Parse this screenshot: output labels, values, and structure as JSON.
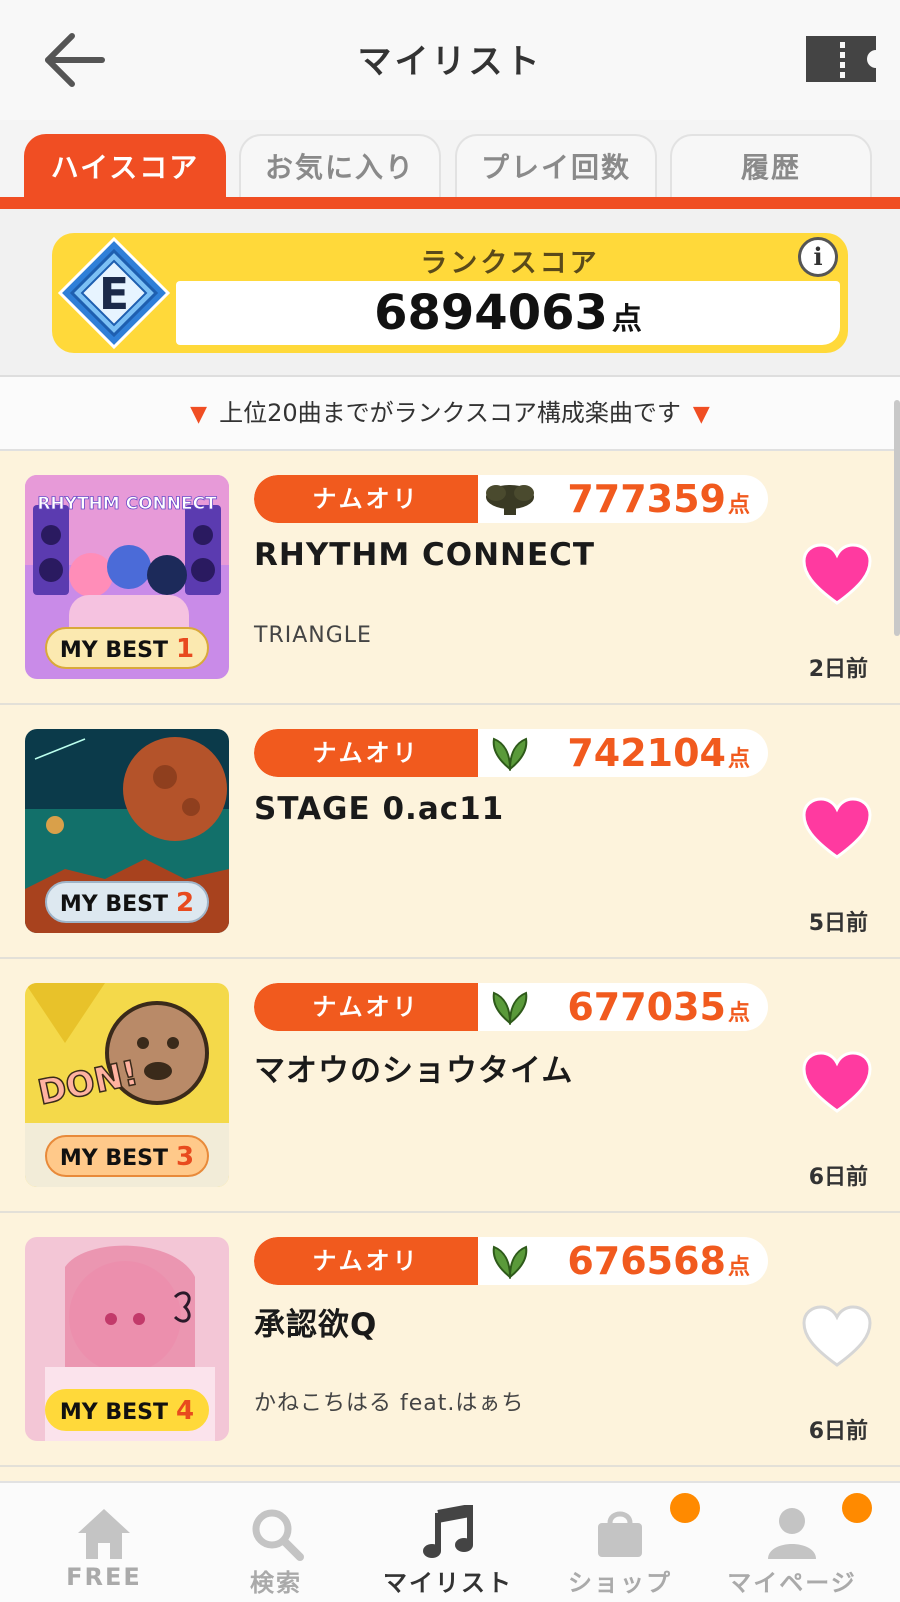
{
  "header": {
    "title": "マイリスト",
    "back_icon": "arrow-left-icon",
    "ticket_icon": "ticket-icon"
  },
  "tabs": [
    {
      "label": "ハイスコア",
      "active": true
    },
    {
      "label": "お気に入り",
      "active": false
    },
    {
      "label": "プレイ回数",
      "active": false
    },
    {
      "label": "履歴",
      "active": false
    }
  ],
  "rank": {
    "label": "ランクスコア",
    "grade": "E",
    "value": "6894063",
    "unit": "点",
    "info_label": "i"
  },
  "notice": {
    "text": "上位20曲までがランクスコア構成楽曲です"
  },
  "songs": [
    {
      "rank_label": "MY BEST",
      "rank": "1",
      "genre": "ナムオリ",
      "crown_icon": "dark-crown-icon",
      "score": "777359",
      "score_unit": "点",
      "title": "RHYTHM CONNECT",
      "artist": "TRIANGLE",
      "favorite": true,
      "ago": "2日前",
      "jacket_text": "RHYTHM CONNECT"
    },
    {
      "rank_label": "MY BEST",
      "rank": "2",
      "genre": "ナムオリ",
      "crown_icon": "green-leaf-icon",
      "score": "742104",
      "score_unit": "点",
      "title": "STAGE 0.ac11",
      "artist": "",
      "favorite": true,
      "ago": "5日前"
    },
    {
      "rank_label": "MY BEST",
      "rank": "3",
      "genre": "ナムオリ",
      "crown_icon": "green-leaf-icon",
      "score": "677035",
      "score_unit": "点",
      "title": "マオウのショウタイム",
      "artist": "",
      "favorite": true,
      "ago": "6日前",
      "jacket_text": "DON!"
    },
    {
      "rank_label": "MY BEST",
      "rank": "4",
      "genre": "ナムオリ",
      "crown_icon": "green-leaf-icon",
      "score": "676568",
      "score_unit": "点",
      "title": "承認欲Q",
      "artist": "かねこちはる feat.はぁち",
      "favorite": false,
      "ago": "6日前"
    }
  ],
  "nav": [
    {
      "label": "FREE",
      "icon": "home-icon",
      "active": false,
      "badge": false
    },
    {
      "label": "検索",
      "icon": "search-icon",
      "active": false,
      "badge": false
    },
    {
      "label": "マイリスト",
      "icon": "music-note-icon",
      "active": true,
      "badge": false
    },
    {
      "label": "ショップ",
      "icon": "shopping-bag-icon",
      "active": false,
      "badge": true
    },
    {
      "label": "マイページ",
      "icon": "user-icon",
      "active": false,
      "badge": true
    }
  ],
  "colors": {
    "accent": "#f04e23",
    "score": "#f15a1e",
    "rank_card": "#ffd93a",
    "heart": "#ff3aa0",
    "list_bg": "#fdf3dc",
    "badge": "#ff8a00"
  }
}
